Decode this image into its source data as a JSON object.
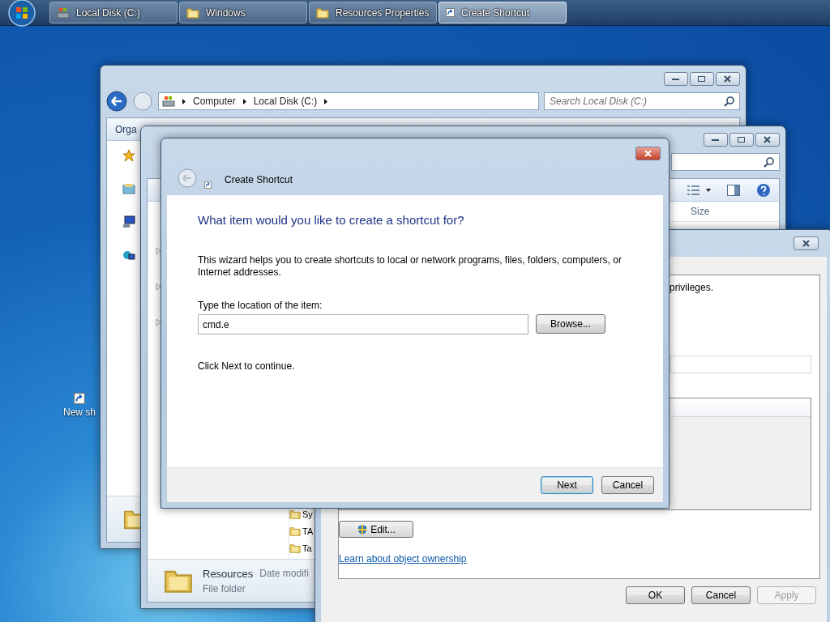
{
  "taskbar": {
    "items": [
      {
        "label": "Local Disk (C:)",
        "selected": false
      },
      {
        "label": "Windows",
        "selected": false
      },
      {
        "label": "Resources Properties",
        "selected": false
      },
      {
        "label": "Create Shortcut",
        "selected": true
      }
    ]
  },
  "desktop_icons": [
    {
      "label": "New sh"
    }
  ],
  "explorer": {
    "breadcrumb": [
      "Computer",
      "Local Disk (C:)"
    ],
    "search": {
      "placeholder": "Search Local Disk (C:)"
    },
    "toolbar": [
      "Orga"
    ]
  },
  "folder_window": {
    "columns": [
      "Size"
    ],
    "files": [
      "Sy",
      "TA",
      "Ta"
    ],
    "details": {
      "name": "Resources",
      "label": "Date modifi",
      "type": "File folder"
    }
  },
  "properties": {
    "text": "privileges.",
    "edit_button": "Edit...",
    "link": "Learn about object ownership",
    "buttons": [
      {
        "label": "OK",
        "disabled": false
      },
      {
        "label": "Cancel",
        "disabled": false
      },
      {
        "label": "Apply",
        "disabled": true
      }
    ]
  },
  "wizard": {
    "title": "Create Shortcut",
    "heading": "What item would you like to create a shortcut for?",
    "description": "This wizard helps you to create shortcuts to local or network programs, files, folders, computers, or Internet addresses.",
    "field": {
      "label": "Type the location of the item:",
      "value": "cmd.e"
    },
    "browse": "Browse...",
    "hint": "Click Next to continue.",
    "buttons": [
      {
        "label": "Next",
        "default": true
      },
      {
        "label": "Cancel",
        "default": false
      }
    ]
  }
}
